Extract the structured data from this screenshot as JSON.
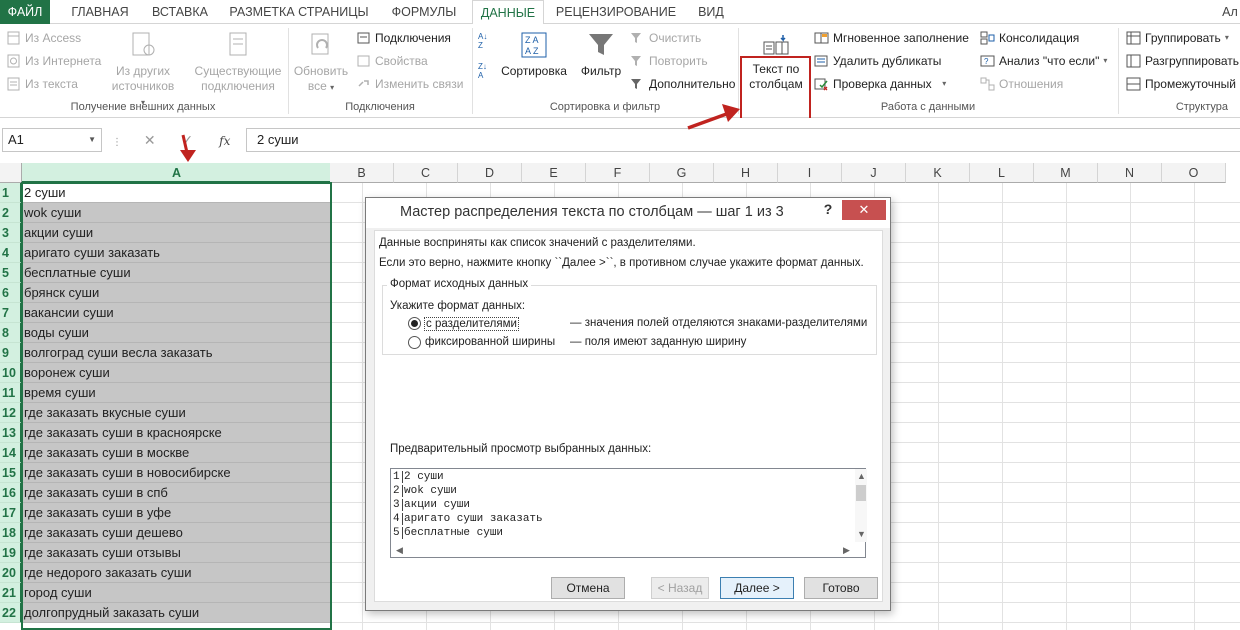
{
  "tabs": [
    {
      "label": "ФАЙЛ"
    },
    {
      "label": "ГЛАВНАЯ"
    },
    {
      "label": "ВСТАВКА"
    },
    {
      "label": "РАЗМЕТКА СТРАНИЦЫ"
    },
    {
      "label": "ФОРМУЛЫ"
    },
    {
      "label": "ДАННЫЕ"
    },
    {
      "label": "РЕЦЕНЗИРОВАНИЕ"
    },
    {
      "label": "ВИД"
    }
  ],
  "user_label": "Ал",
  "ribbon": {
    "external": {
      "from_access": "Из Access",
      "from_web": "Из Интернета",
      "from_text": "Из текста",
      "other_sources": "Из других источников",
      "existing": "Существующие подключения",
      "group": "Получение внешних данных"
    },
    "connections": {
      "refresh_all": "Обновить все",
      "connections": "Подключения",
      "properties": "Свойства",
      "edit_links": "Изменить связи",
      "group": "Подключения"
    },
    "sort": {
      "sort": "Сортировка",
      "filter": "Фильтр",
      "clear": "Очистить",
      "reapply": "Повторить",
      "advanced": "Дополнительно",
      "group": "Сортировка и фильтр"
    },
    "tools": {
      "text_to_columns": "Текст по столбцам",
      "flash_fill": "Мгновенное заполнение",
      "remove_duplicates": "Удалить дубликаты",
      "validation": "Проверка данных",
      "consolidate": "Консолидация",
      "what_if": "Анализ \"что если\"",
      "relationships": "Отношения",
      "group": "Работа с данными"
    },
    "outline": {
      "group_btn": "Группировать",
      "ungroup": "Разгруппировать",
      "subtotal": "Промежуточный",
      "group": "Структура"
    }
  },
  "formula_bar": {
    "name_box": "A1",
    "fx": "fx",
    "value": "2 суши"
  },
  "columns": [
    "A",
    "B",
    "C",
    "D",
    "E",
    "F",
    "G",
    "H",
    "I",
    "J",
    "K",
    "L",
    "M",
    "N",
    "O"
  ],
  "rows": [
    {
      "n": "1",
      "a": "2 суши"
    },
    {
      "n": "2",
      "a": "wok суши"
    },
    {
      "n": "3",
      "a": "акции суши"
    },
    {
      "n": "4",
      "a": "аригато суши заказать"
    },
    {
      "n": "5",
      "a": "бесплатные суши"
    },
    {
      "n": "6",
      "a": "брянск суши"
    },
    {
      "n": "7",
      "a": "вакансии суши"
    },
    {
      "n": "8",
      "a": "воды суши"
    },
    {
      "n": "9",
      "a": "волгоград суши весла заказать"
    },
    {
      "n": "10",
      "a": "воронеж суши"
    },
    {
      "n": "11",
      "a": "время суши"
    },
    {
      "n": "12",
      "a": "где заказать вкусные суши"
    },
    {
      "n": "13",
      "a": "где заказать суши в красноярске"
    },
    {
      "n": "14",
      "a": "где заказать суши в москве"
    },
    {
      "n": "15",
      "a": "где заказать суши в новосибирске"
    },
    {
      "n": "16",
      "a": "где заказать суши в спб"
    },
    {
      "n": "17",
      "a": "где заказать суши в уфе"
    },
    {
      "n": "18",
      "a": "где заказать суши дешево"
    },
    {
      "n": "19",
      "a": "где заказать суши отзывы"
    },
    {
      "n": "20",
      "a": "где недорого заказать суши"
    },
    {
      "n": "21",
      "a": "город суши"
    },
    {
      "n": "22",
      "a": "долгопрудный заказать суши"
    }
  ],
  "dialog": {
    "title": "Мастер распределения текста по столбцам — шаг 1 из 3",
    "help": "?",
    "close": "✕",
    "line1": "Данные восприняты как список значений с разделителями.",
    "line2": "Если это верно, нажмите кнопку ``Далее >``, в противном случае укажите формат данных.",
    "fieldset": "Формат исходных данных",
    "specify": "Укажите формат данных:",
    "opt1_label": "с разделителями",
    "opt1_desc": "— значения полей отделяются знаками-разделителями",
    "opt2_label": "фиксированной ширины",
    "opt2_desc": "— поля имеют заданную ширину",
    "preview_label": "Предварительный просмотр выбранных данных:",
    "preview": [
      {
        "n": "1",
        "t": "2 суши"
      },
      {
        "n": "2",
        "t": "wok суши"
      },
      {
        "n": "3",
        "t": "акции суши"
      },
      {
        "n": "4",
        "t": "аригато суши заказать"
      },
      {
        "n": "5",
        "t": "бесплатные суши"
      }
    ],
    "buttons": {
      "cancel": "Отмена",
      "back": "< Назад",
      "next": "Далее >",
      "finish": "Готово"
    }
  },
  "colors": {
    "excel_green": "#217346",
    "annotation_red": "#c0231f",
    "close_red": "#c75050"
  }
}
